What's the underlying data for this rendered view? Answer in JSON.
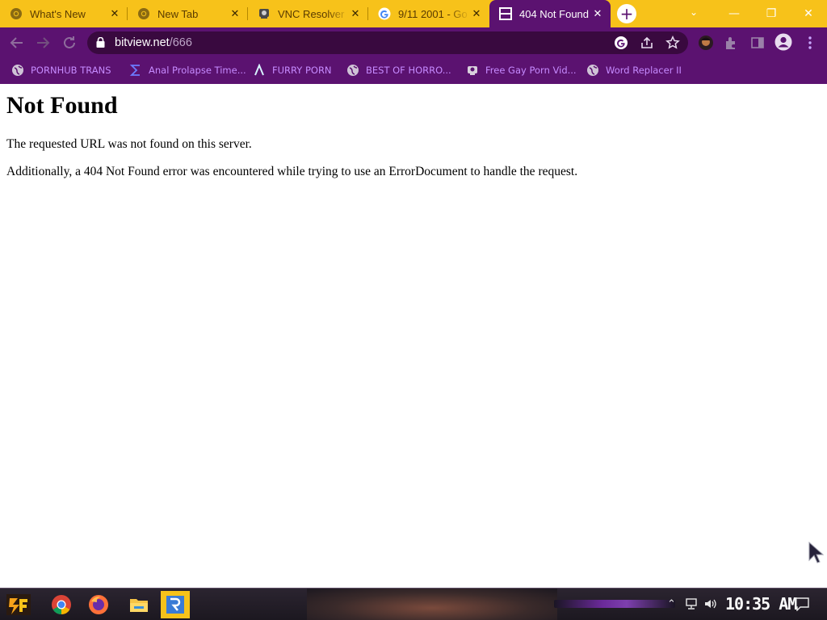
{
  "browser": {
    "tabs": [
      {
        "title": "What's New",
        "favicon": "chrome-icon",
        "active": false,
        "close": "✕"
      },
      {
        "title": "New Tab",
        "favicon": "chrome-icon",
        "active": false,
        "close": "✕"
      },
      {
        "title": "VNC Resolver",
        "favicon": "vnc-icon",
        "active": false,
        "close": "✕"
      },
      {
        "title": "9/11 2001 - Go",
        "favicon": "google-icon",
        "active": false,
        "close": "✕"
      },
      {
        "title": "404 Not Found",
        "favicon": "bitview-icon",
        "active": true,
        "close": "✕"
      }
    ],
    "new_tab_label": "+",
    "tab_search_label": "⌄",
    "window_controls": {
      "minimize": "—",
      "restore": "❐",
      "close": "✕"
    },
    "address": {
      "host": "bitview.net",
      "path": "/666"
    },
    "bookmarks": [
      {
        "label": "PORNHUB TRANS",
        "icon": "globe-icon"
      },
      {
        "label": "Anal Prolapse Time...",
        "icon": "sigma-icon"
      },
      {
        "label": "FURRY PORN",
        "icon": "lambda-icon"
      },
      {
        "label": "BEST OF HORRO...",
        "icon": "globe-icon"
      },
      {
        "label": "Free Gay Porn Vid...",
        "icon": "site-icon"
      },
      {
        "label": "Word Replacer II",
        "icon": "globe-icon"
      }
    ],
    "colors": {
      "theme": "#5b1270",
      "tabstrip": "#f7c21a",
      "bookmark_text": "#c68bff"
    }
  },
  "page": {
    "heading": "Not Found",
    "line1": "The requested URL was not found on this server.",
    "line2": "Additionally, a 404 Not Found error was encountered while trying to use an ErrorDocument to handle the request."
  },
  "taskbar": {
    "apps": [
      "chrome-icon",
      "firefox-icon",
      "file-explorer-icon",
      "rufus-icon"
    ],
    "clock": "10:35 AM",
    "tray_icons": [
      "chevron-up-icon",
      "network-icon",
      "volume-icon",
      "notification-icon"
    ]
  }
}
